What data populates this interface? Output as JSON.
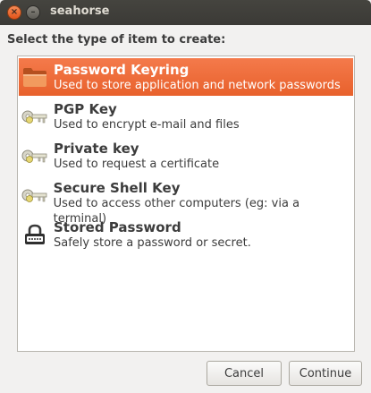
{
  "window": {
    "title": "seahorse",
    "close_glyph": "×",
    "minimize_glyph": "–"
  },
  "dialog": {
    "prompt": "Select the type of item to create:"
  },
  "items": [
    {
      "name": "Password Keyring",
      "description": "Used to store application and network passwords",
      "icon": "folder-icon",
      "selected": true
    },
    {
      "name": "PGP Key",
      "description": "Used to encrypt e-mail and files",
      "icon": "key-icon",
      "selected": false
    },
    {
      "name": "Private key",
      "description": "Used to request a certificate",
      "icon": "key-icon",
      "selected": false
    },
    {
      "name": "Secure Shell Key",
      "description": "Used to access other computers (eg: via a terminal)",
      "icon": "key-icon",
      "selected": false
    },
    {
      "name": "Stored Password",
      "description": "Safely store a password or secret.",
      "icon": "lock-icon",
      "selected": false
    }
  ],
  "buttons": {
    "cancel": "Cancel",
    "continue": "Continue"
  },
  "colors": {
    "selection": "#e9652f",
    "titlebar": "#3f3e3a",
    "close_button": "#ef6d37"
  }
}
